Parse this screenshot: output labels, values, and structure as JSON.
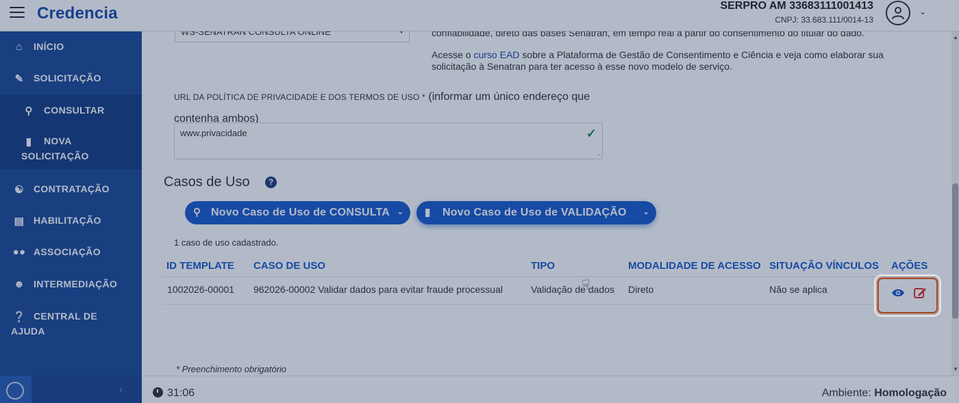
{
  "header": {
    "app_name": "Credencia",
    "user_name": "SERPRO AM 33683111001413",
    "user_cnpj": "CNPJ: 33.683.111/0014-13"
  },
  "sidebar": {
    "items": [
      {
        "label": "INÍCIO",
        "icon": "home-icon"
      },
      {
        "label": "SOLICITAÇÃO",
        "icon": "edit-document-icon"
      },
      {
        "label": "CONSULTAR",
        "icon": "search-icon"
      },
      {
        "label_line1": "NOVA",
        "label_line2": "SOLICITAÇÃO",
        "icon": "file-icon"
      },
      {
        "label": "CONTRATAÇÃO",
        "icon": "handshake-icon"
      },
      {
        "label": "HABILITAÇÃO",
        "icon": "id-card-icon"
      },
      {
        "label": "ASSOCIAÇÃO",
        "icon": "users-icon"
      },
      {
        "label": "INTERMEDIAÇÃO",
        "icon": "user-network-icon"
      },
      {
        "label_line1": "CENTRAL DE",
        "label_line2": "AJUDA",
        "icon": "question-circle-icon"
      }
    ]
  },
  "form": {
    "service_select_value": "WS-SENATRAN CONSULTA ONLINE",
    "info_top": "confiabilidade, direto das bases Senatran, em tempo real a partir do consentimento do titular do dado.",
    "info_p_before": "Acesse o ",
    "info_p_link": "curso EAD",
    "info_p_after": " sobre a Plataforma de Gestão de Consentimento e Ciência e veja como elaborar sua solicitação à Senatran para ter acesso à esse novo modelo de serviço.",
    "url_label_small": "URL DA POLÍTICA DE PRIVACIDADE E DOS TERMOS DE USO *",
    "url_label_big": " (informar um único endereço que contenha ambos)",
    "url_value": "www.privacidade",
    "url_valid_icon": "check-icon"
  },
  "use_cases": {
    "title": "Casos de Uso",
    "help_icon": "question-circle-icon",
    "btn_consulta": "Novo Caso de Uso de CONSULTA",
    "btn_validacao": "Novo Caso de Uso de VALIDAÇÃO",
    "count_text": "1 caso de uso cadastrado.",
    "columns": [
      "ID TEMPLATE",
      "CASO DE USO",
      "TIPO",
      "MODALIDADE DE ACESSO",
      "SITUAÇÃO VÍNCULOS",
      "AÇÕES"
    ],
    "rows": [
      {
        "id_template": "1002026-00001",
        "caso_de_uso": "962026-00002 Validar dados para evitar fraude processual",
        "tipo": "Validação de dados",
        "modalidade": "Direto",
        "situacao": "Não se aplica"
      }
    ],
    "required_note": "* Preenchimento obrigatório"
  },
  "footer": {
    "timer": "31:06",
    "env_label": "Ambiente: ",
    "env_value": "Homologação"
  },
  "colors": {
    "brand": "#1a4aa8",
    "sidebar": "#1d4a99",
    "button": "#1a5bcc",
    "highlight": "#e8590c",
    "valid": "#198754"
  }
}
